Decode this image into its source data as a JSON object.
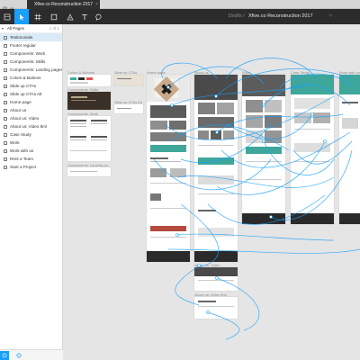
{
  "window": {
    "tab_title": "Xfive.co Reconstruction 2017",
    "tab_close": "×"
  },
  "toolbar": {
    "breadcrumb_project": "Drafts",
    "breadcrumb_sep": "/",
    "breadcrumb_file": "Xfive.co Reconstruction 2017",
    "chevron": "˅",
    "tools": [
      "move-tool",
      "frame-tool",
      "shape-tool",
      "pen-tool",
      "text-tool",
      "comment-tool"
    ],
    "accent": "#18a0fb"
  },
  "sidebar": {
    "caret": "▾",
    "pages_header": "All Pages",
    "pages_count": "1 of 1",
    "pages": [
      {
        "label": "Testimonials",
        "selected": true
      },
      {
        "label": "Footer regular",
        "selected": false
      },
      {
        "label": "Components: Work",
        "selected": false
      },
      {
        "label": "Components: Skills",
        "selected": false
      },
      {
        "label": "Components: Landing pages",
        "selected": false
      },
      {
        "label": "Colors & Buttons",
        "selected": false
      },
      {
        "label": "Slide up CTAs",
        "selected": false
      },
      {
        "label": "Slide up CTAs Alt",
        "selected": false
      },
      {
        "label": "Home page",
        "selected": false
      },
      {
        "label": "About us",
        "selected": false
      },
      {
        "label": "About us: Video",
        "selected": false
      },
      {
        "label": "About us: Video 8ml",
        "selected": false
      },
      {
        "label": "Case Study",
        "selected": false
      },
      {
        "label": "Work",
        "selected": false
      },
      {
        "label": "Work with us",
        "selected": false
      },
      {
        "label": "Rent a Team",
        "selected": false
      },
      {
        "label": "Start a Project",
        "selected": false
      }
    ]
  },
  "canvas": {
    "frame_labels": {
      "colors_buttons": "Colors & Buttons",
      "slide_up_ctas": "Slide up CTAs",
      "home_page": "Home page",
      "about_us": "About us",
      "work": "Work",
      "case_study": "Case Study",
      "work_with_us": "Work with us",
      "components_skills": "Components: Skills",
      "slide_up_ctas_alt": "Slide up CTAs Alt",
      "components_work": "Components: Work",
      "components_landing": "Components: Landing pa...",
      "about_us_video": "About us: Video",
      "about_us_video_8ml": "About us: Video 8ml"
    },
    "prototype_link_color": "#18a0fb",
    "dark_block_color": "#3b3028",
    "teal_color": "#3ea79a"
  }
}
